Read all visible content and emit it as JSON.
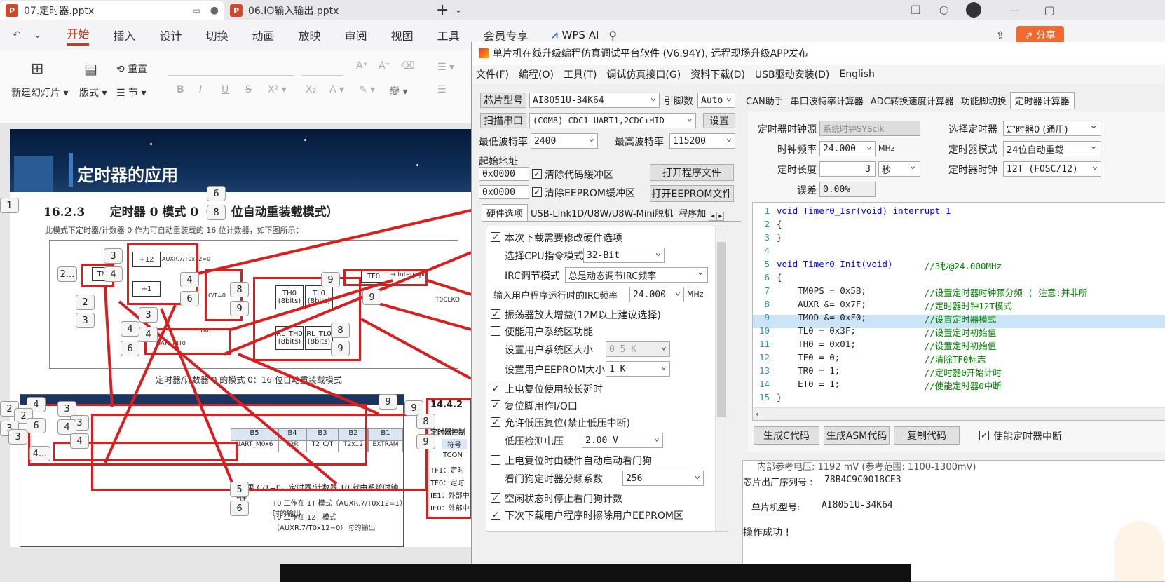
{
  "ppt": {
    "tabs": [
      {
        "label": "07.定时器.pptx"
      },
      {
        "label": "06.IO输入输出.pptx"
      }
    ],
    "new_tab": "+",
    "menu": [
      "开始",
      "插入",
      "设计",
      "切换",
      "动画",
      "放映",
      "审阅",
      "视图",
      "工具",
      "会员专享"
    ],
    "wps_ai": "WPS AI",
    "share": "分享",
    "ribbon": {
      "new_slide": "新建幻灯片",
      "layout": "版式",
      "section": "节",
      "reset": "重置"
    },
    "slide": {
      "title": "定时器的应用",
      "heading": "16.2.3      定时器 0 模式 0（16 位自动重装载模式）",
      "desc": "此模式下定时器/计数器 0 作为可自动重装载的 16 位计数器，如下图所示：",
      "caption": "定时器/计数器 0 的模式 0：16 位自动重装载模式",
      "section_1442": "14.4.2",
      "reg_title": "定时器控制",
      "tcon": "TCON",
      "tf1": "TF1：定时",
      "tf0": "TF0：定时",
      "ie1": "IE1：外部中",
      "ie0": "IE0：外部中",
      "symbol": "符号",
      "b_headers": [
        "B5",
        "B4",
        "B3",
        "B2",
        "B1"
      ],
      "b_values": [
        "UART_M0x6",
        "T2R",
        "T2_C/T",
        "T2x12",
        "EXTRAM"
      ],
      "c_t_line": "如果 C/T=0，定时器/计数器 T0 就由系统时钟计",
      "t0_1t": "T0 工作在 1T 模式（AUXR.7/T0x12=1）时的输出",
      "t0_12t": "T0 工作在 12T 模式（AUXR.7/T0x12=0）时的输出"
    },
    "side_numbers": [
      "1",
      "2",
      "2",
      "3",
      "3",
      "4",
      "4",
      "6",
      "3",
      "3"
    ]
  },
  "stc": {
    "title": "单片机在线升级编程仿真调试平台软件 (V6.94Y), 远程现场升级APP发布",
    "menu": [
      "文件(F)",
      "编程(O)",
      "工具(T)",
      "调试仿真接口(G)",
      "资料下载(D)",
      "USB驱动安装(D)",
      "English"
    ],
    "chip_label": "芯片型号",
    "chip_value": "AI8051U-34K64",
    "pins_label": "引脚数",
    "pins_value": "Auto",
    "scan_label": "扫描串口",
    "port_value": "(COM8) CDC1-UART1,2CDC+HID",
    "settings": "设置",
    "min_baud_label": "最低波特率",
    "min_baud": "2400",
    "max_baud_label": "最高波特率",
    "max_baud": "115200",
    "start_addr_label": "起始地址",
    "addr1": "0x0000",
    "addr2": "0x0000",
    "clear_code": "清除代码缓冲区",
    "clear_eeprom": "清除EEPROM缓冲区",
    "open_prog": "打开程序文件",
    "open_eeprom": "打开EEPROM文件",
    "hw_tabs": [
      "硬件选项",
      "USB-Link1D/U8W/U8W-Mini脱机",
      "程序加"
    ],
    "hw": {
      "modify": "本次下载需要修改硬件选项",
      "cpu_mode_label": "选择CPU指令模式",
      "cpu_mode": "32-Bit",
      "irc_label": "IRC调节模式",
      "irc_mode": "总是动态调节IRC频率",
      "irc_freq_label": "输入用户程序运行时的IRC频率",
      "irc_freq": "24.000",
      "mhz": "MHz",
      "amp": "振荡器放大增益(12M以上建议选择)",
      "sys_area": "使能用户系统区功能",
      "sys_size_label": "设置用户系统区大小",
      "sys_size": "0 5 K",
      "eeprom_size_label": "设置用户EEPROM大小",
      "eeprom_size": "1   K",
      "long_delay": "上电复位使用较长延时",
      "reset_io": "复位脚用作I/O口",
      "low_volt": "允许低压复位(禁止低压中断)",
      "low_volt_label": "低压检测电压",
      "low_volt_value": "2.00 V",
      "watchdog": "上电复位时由硬件自动启动看门狗",
      "wdt_label": "看门狗定时器分频系数",
      "wdt_value": "256",
      "idle_stop": "空闲状态时停止看门狗计数",
      "erase_eeprom": "下次下载用户程序时擦除用户EEPROM区"
    },
    "right_tabs": [
      "CAN助手",
      "串口波特率计算器",
      "ADC转换速度计算器",
      "功能脚切换",
      "定时器计算器"
    ],
    "timer": {
      "src_label": "定时器时钟源",
      "src": "系统时钟SYSclk",
      "sel_label": "选择定时器",
      "sel": "定时器0 (通用)",
      "freq_label": "时钟频率",
      "freq": "24.000",
      "freq_unit": "MHz",
      "mode_label": "定时器模式",
      "mode": "24位自动重载",
      "len_label": "定时长度",
      "len": "3",
      "len_unit": "秒",
      "clk_label": "定时器时钟",
      "clk": "12T (FOSC/12)",
      "err_label": "误差",
      "err": "0.00%"
    },
    "code": [
      {
        "n": "1",
        "t": "void Timer0_Isr(void) interrupt 1",
        "c": ""
      },
      {
        "n": "2",
        "t": "{",
        "c": ""
      },
      {
        "n": "3",
        "t": "}",
        "c": ""
      },
      {
        "n": "4",
        "t": "",
        "c": ""
      },
      {
        "n": "5",
        "t": "void Timer0_Init(void)      ",
        "c": "//3秒@24.000MHz"
      },
      {
        "n": "6",
        "t": "{",
        "c": ""
      },
      {
        "n": "7",
        "t": "    TM0PS = 0x5B;           ",
        "c": "//设置定时器时钟预分频 ( 注意:并非所"
      },
      {
        "n": "8",
        "t": "    AUXR &= 0x7F;           ",
        "c": "//定时器时钟12T模式"
      },
      {
        "n": "9",
        "t": "    TMOD &= 0xF0;           ",
        "c": "//设置定时器模式"
      },
      {
        "n": "10",
        "t": "    TL0 = 0x3F;             ",
        "c": "//设置定时初始值"
      },
      {
        "n": "11",
        "t": "    TH0 = 0x01;             ",
        "c": "//设置定时初始值"
      },
      {
        "n": "12",
        "t": "    TF0 = 0;                ",
        "c": "//清除TF0标志"
      },
      {
        "n": "13",
        "t": "    TR0 = 1;                ",
        "c": "//定时器0开始计时"
      },
      {
        "n": "14",
        "t": "    ET0 = 1;                ",
        "c": "//使能定时器0中断"
      },
      {
        "n": "15",
        "t": "}",
        "c": ""
      }
    ],
    "gen_c": "生成C代码",
    "gen_asm": "生成ASM代码",
    "copy": "复制代码",
    "enable_int": "使能定时器中断",
    "log": {
      "ref": "内部参考电压: 1192 mV (参考范围: 1100-1300mV)",
      "serial_label": "芯片出厂序列号 :",
      "serial": "78B4C9C0018CE3",
      "model_label": "单片机型号:",
      "model": "AI8051U-34K64",
      "ok": "操作成功 !"
    }
  }
}
